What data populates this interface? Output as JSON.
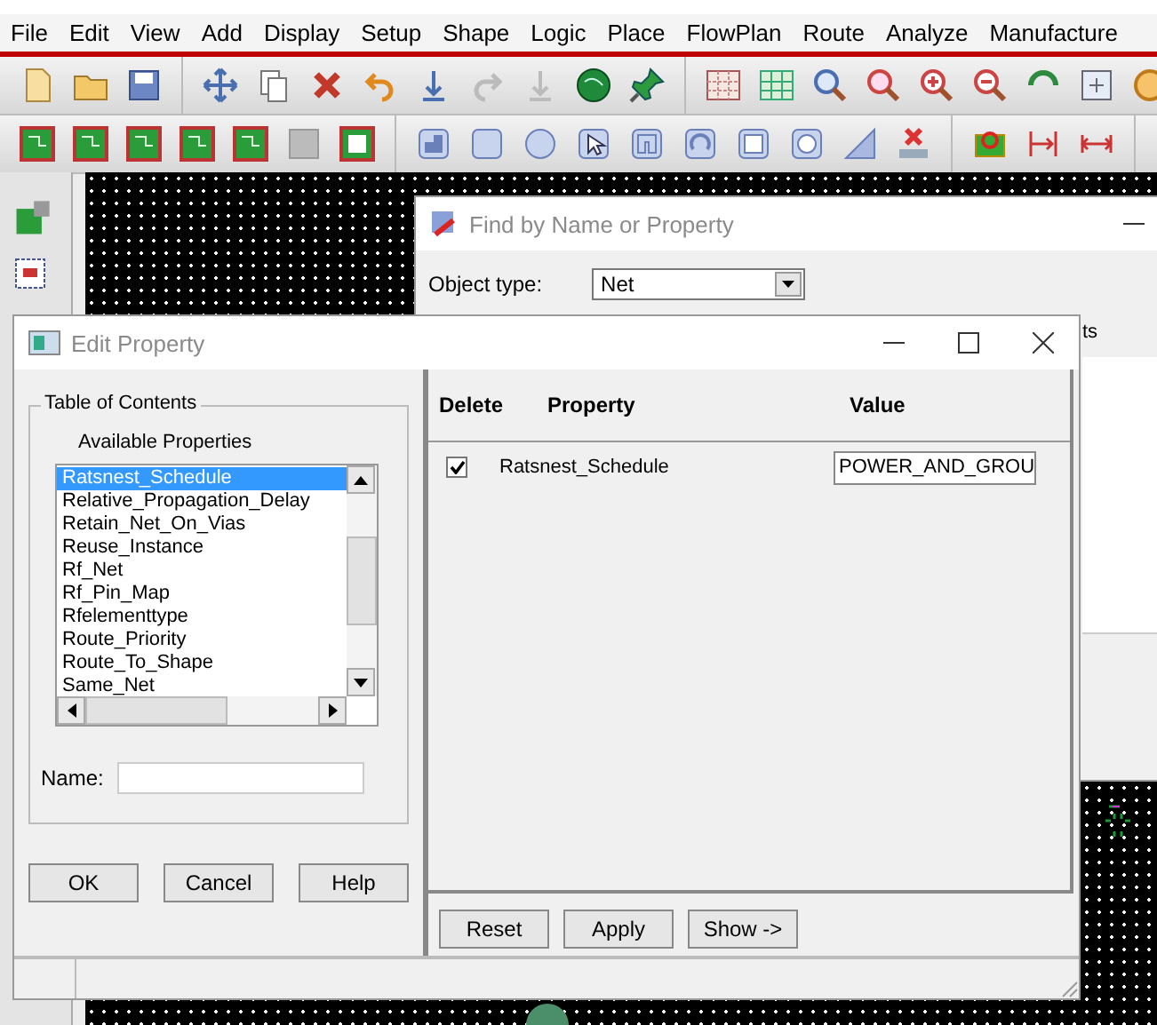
{
  "menu": [
    {
      "label": "File"
    },
    {
      "label": "Edit"
    },
    {
      "label": "View"
    },
    {
      "label": "Add"
    },
    {
      "label": "Display"
    },
    {
      "label": "Setup"
    },
    {
      "label": "Shape"
    },
    {
      "label": "Logic"
    },
    {
      "label": "Place"
    },
    {
      "label": "FlowPlan"
    },
    {
      "label": "Route"
    },
    {
      "label": "Analyze"
    },
    {
      "label": "Manufacture"
    }
  ],
  "find_dialog": {
    "title": "Find by Name or Property",
    "object_type_label": "Object type:",
    "object_type": "Net",
    "group_label": "ts"
  },
  "edit_dialog": {
    "title": "Edit Property",
    "toc_label": "Table of Contents",
    "available_label": "Available Properties",
    "properties": [
      {
        "label": "Ratsnest_Schedule",
        "selected": true
      },
      {
        "label": "Relative_Propagation_Delay",
        "selected": false
      },
      {
        "label": "Retain_Net_On_Vias",
        "selected": false
      },
      {
        "label": "Reuse_Instance",
        "selected": false
      },
      {
        "label": "Rf_Net",
        "selected": false
      },
      {
        "label": "Rf_Pin_Map",
        "selected": false
      },
      {
        "label": "Rfelementtype",
        "selected": false
      },
      {
        "label": "Route_Priority",
        "selected": false
      },
      {
        "label": "Route_To_Shape",
        "selected": false
      },
      {
        "label": "Same_Net",
        "selected": false
      }
    ],
    "name_label": "Name:",
    "buttons": [
      "OK",
      "Cancel",
      "Help"
    ],
    "table": {
      "columns": [
        "Delete",
        "Property",
        "Value"
      ],
      "rows": [
        {
          "delete": true,
          "property": "Ratsnest_Schedule",
          "value": "POWER_AND_GROU"
        }
      ]
    },
    "action_buttons": [
      "Reset",
      "Apply",
      "Show ->"
    ]
  }
}
